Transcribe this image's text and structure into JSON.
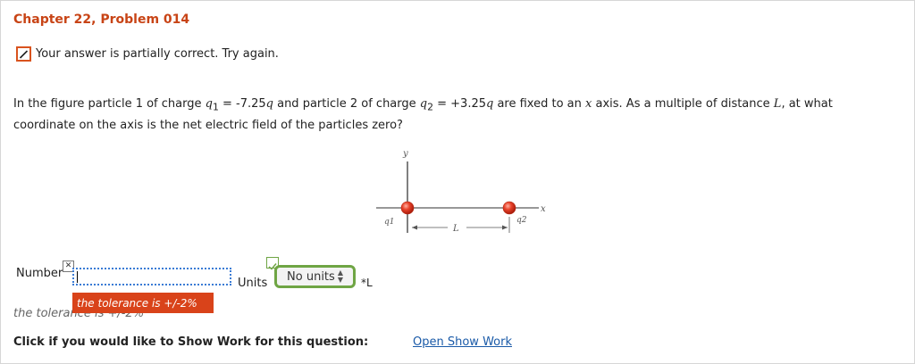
{
  "problem": {
    "title": "Chapter 22, Problem 014",
    "status_text": "Your answer is partially correct.  Try again."
  },
  "question": {
    "p1": "In the figure particle 1 of charge ",
    "q1_sym": "q",
    "q1_sub": "1",
    "p2": " = -7.25",
    "p3": " and particle 2 of charge ",
    "q2_sym": "q",
    "q2_sub": "2",
    "p4": " = +3.25",
    "p5": " are fixed to an ",
    "x_var": "x",
    "p6": " axis. As a multiple of distance ",
    "L_var": "L",
    "p7": ", at what coordinate on the axis is the net electric field of the particles zero?"
  },
  "figure": {
    "y_label": "y",
    "x_label": "x",
    "q1_label": "q1",
    "q2_label": "q2",
    "L_label": "L",
    "particle_color": "#e8422a"
  },
  "answer": {
    "number_label": "Number",
    "number_value": "",
    "units_label": "Units",
    "units_selected": "No units",
    "suffix": "*L",
    "tooltip": "the tolerance is +/-2%",
    "under_text": "the tolerance is +/-2%"
  },
  "work": {
    "prompt": "Click if you would like to Show Work for this question:",
    "link_label": "Open Show Work"
  },
  "colors": {
    "title": "#c84416",
    "status_box": "#d9531e",
    "units_border": "#6fa544",
    "tooltip_bg": "#d9431a",
    "link": "#1a5aa8"
  }
}
